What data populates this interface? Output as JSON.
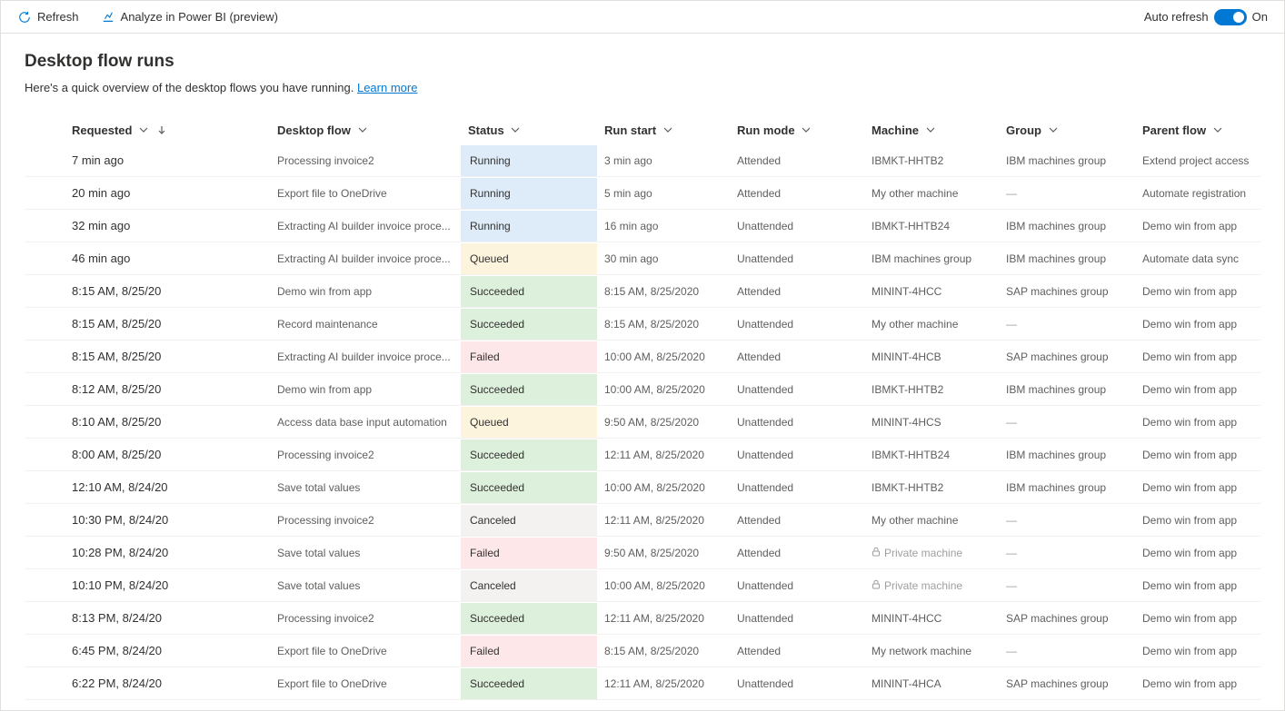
{
  "toolbar": {
    "refresh_label": "Refresh",
    "analyze_label": "Analyze in Power BI (preview)",
    "auto_refresh_label": "Auto refresh",
    "auto_refresh_state": "On"
  },
  "page": {
    "title": "Desktop flow runs",
    "subtitle_prefix": "Here's a quick overview of the desktop flows you have running. ",
    "learn_more": "Learn more"
  },
  "columns": {
    "requested": "Requested",
    "desktop_flow": "Desktop flow",
    "status": "Status",
    "run_start": "Run start",
    "run_mode": "Run mode",
    "machine": "Machine",
    "group": "Group",
    "parent_flow": "Parent flow"
  },
  "rows": [
    {
      "requested": "7 min ago",
      "desktop_flow": "Processing invoice2",
      "status": "Running",
      "run_start": "3 min ago",
      "run_mode": "Attended",
      "machine": "IBMKT-HHTB2",
      "group": "IBM machines group",
      "parent_flow": "Extend project access"
    },
    {
      "requested": "20 min ago",
      "desktop_flow": "Export file to OneDrive",
      "status": "Running",
      "run_start": "5 min ago",
      "run_mode": "Attended",
      "machine": "My other machine",
      "group": "—",
      "parent_flow": "Automate registration"
    },
    {
      "requested": "32 min ago",
      "desktop_flow": "Extracting AI builder invoice proce...",
      "status": "Running",
      "run_start": "16 min ago",
      "run_mode": "Unattended",
      "machine": "IBMKT-HHTB24",
      "group": "IBM machines group",
      "parent_flow": "Demo win from app"
    },
    {
      "requested": "46 min ago",
      "desktop_flow": "Extracting AI builder invoice proce...",
      "status": "Queued",
      "run_start": "30 min ago",
      "run_mode": "Unattended",
      "machine": "IBM machines group",
      "group": "IBM machines group",
      "parent_flow": "Automate data sync"
    },
    {
      "requested": "8:15 AM, 8/25/20",
      "desktop_flow": "Demo win from app",
      "status": "Succeeded",
      "run_start": "8:15 AM, 8/25/2020",
      "run_mode": "Attended",
      "machine": "MININT-4HCC",
      "group": "SAP machines group",
      "parent_flow": "Demo win from app"
    },
    {
      "requested": "8:15 AM, 8/25/20",
      "desktop_flow": "Record maintenance",
      "status": "Succeeded",
      "run_start": "8:15 AM, 8/25/2020",
      "run_mode": "Unattended",
      "machine": "My other machine",
      "group": "—",
      "parent_flow": "Demo win from app"
    },
    {
      "requested": "8:15 AM, 8/25/20",
      "desktop_flow": "Extracting AI builder invoice proce...",
      "status": "Failed",
      "run_start": "10:00 AM, 8/25/2020",
      "run_mode": "Attended",
      "machine": "MININT-4HCB",
      "group": "SAP machines group",
      "parent_flow": "Demo win from app"
    },
    {
      "requested": "8:12 AM, 8/25/20",
      "desktop_flow": "Demo win from app",
      "status": "Succeeded",
      "run_start": "10:00 AM, 8/25/2020",
      "run_mode": "Unattended",
      "machine": "IBMKT-HHTB2",
      "group": "IBM machines group",
      "parent_flow": "Demo win from app"
    },
    {
      "requested": "8:10 AM, 8/25/20",
      "desktop_flow": "Access data base input automation",
      "status": "Queued",
      "run_start": "9:50 AM, 8/25/2020",
      "run_mode": "Unattended",
      "machine": "MININT-4HCS",
      "group": "—",
      "parent_flow": "Demo win from app"
    },
    {
      "requested": "8:00 AM, 8/25/20",
      "desktop_flow": "Processing invoice2",
      "status": "Succeeded",
      "run_start": "12:11 AM, 8/25/2020",
      "run_mode": "Unattended",
      "machine": "IBMKT-HHTB24",
      "group": "IBM machines group",
      "parent_flow": "Demo win from app"
    },
    {
      "requested": "12:10 AM, 8/24/20",
      "desktop_flow": "Save total values",
      "status": "Succeeded",
      "run_start": "10:00 AM, 8/25/2020",
      "run_mode": "Unattended",
      "machine": "IBMKT-HHTB2",
      "group": "IBM machines group",
      "parent_flow": "Demo win from app"
    },
    {
      "requested": "10:30 PM, 8/24/20",
      "desktop_flow": "Processing invoice2",
      "status": "Canceled",
      "run_start": "12:11 AM, 8/25/2020",
      "run_mode": "Attended",
      "machine": "My other machine",
      "group": "—",
      "parent_flow": "Demo win from app"
    },
    {
      "requested": "10:28 PM, 8/24/20",
      "desktop_flow": "Save total values",
      "status": "Failed",
      "run_start": "9:50 AM, 8/25/2020",
      "run_mode": "Attended",
      "machine": "Private machine",
      "machine_private": true,
      "group": "—",
      "parent_flow": "Demo win from app"
    },
    {
      "requested": "10:10 PM, 8/24/20",
      "desktop_flow": "Save total values",
      "status": "Canceled",
      "run_start": "10:00 AM, 8/25/2020",
      "run_mode": "Unattended",
      "machine": "Private machine",
      "machine_private": true,
      "group": "—",
      "parent_flow": "Demo win from app"
    },
    {
      "requested": "8:13 PM, 8/24/20",
      "desktop_flow": "Processing invoice2",
      "status": "Succeeded",
      "run_start": "12:11 AM, 8/25/2020",
      "run_mode": "Unattended",
      "machine": "MININT-4HCC",
      "group": "SAP machines group",
      "parent_flow": "Demo win from app"
    },
    {
      "requested": "6:45 PM, 8/24/20",
      "desktop_flow": "Export file to OneDrive",
      "status": "Failed",
      "run_start": "8:15 AM, 8/25/2020",
      "run_mode": "Attended",
      "machine": "My network machine",
      "group": "—",
      "parent_flow": "Demo win from app"
    },
    {
      "requested": "6:22 PM, 8/24/20",
      "desktop_flow": "Export file to OneDrive",
      "status": "Succeeded",
      "run_start": "12:11 AM, 8/25/2020",
      "run_mode": "Unattended",
      "machine": "MININT-4HCA",
      "group": "SAP machines group",
      "parent_flow": "Demo win from app"
    }
  ]
}
